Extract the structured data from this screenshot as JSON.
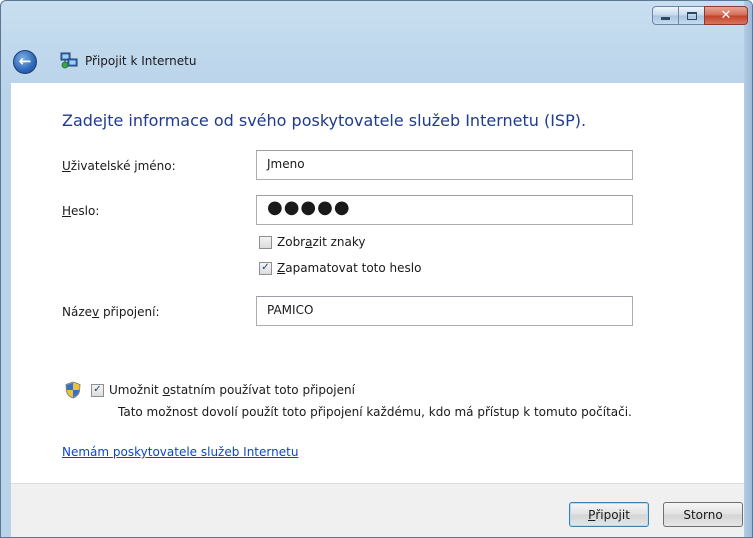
{
  "window": {
    "title": "Připojit k Internetu"
  },
  "heading": "Zadejte informace od svého poskytovatele služeb Internetu (ISP).",
  "form": {
    "username_label": {
      "pre": "",
      "key": "U",
      "post": "živatelské jméno:"
    },
    "username_value": "Jmeno",
    "password_label": {
      "pre": "",
      "key": "H",
      "post": "eslo:"
    },
    "password_value": "●●●●●",
    "show_chars": {
      "checked": false,
      "pre": "Zobr",
      "key": "a",
      "post": "zit znaky"
    },
    "remember": {
      "checked": true,
      "pre": "",
      "key": "Z",
      "post": "apamatovat toto heslo"
    },
    "connection_label": {
      "pre": "Náze",
      "key": "v",
      "post": " připojení:"
    },
    "connection_value": "PAMICO"
  },
  "share": {
    "checked": true,
    "label": {
      "pre": "Umožnit ",
      "key": "o",
      "post": "statním používat toto připojení"
    },
    "description": "Tato možnost dovolí použít toto připojení každému, kdo má přístup k tomuto počítači."
  },
  "link": "Nemám poskytovatele služeb Internetu",
  "buttons": {
    "connect": {
      "pre": "",
      "key": "P",
      "post": "řipojit"
    },
    "cancel": "Storno"
  },
  "colors": {
    "heading": "#1e3b8c",
    "link": "#0a47c7",
    "title_bar": "#c9dff0"
  },
  "icons": [
    "minimize-icon",
    "maximize-icon",
    "close-icon",
    "back-arrow-icon",
    "network-connection-icon",
    "uac-shield-icon"
  ]
}
